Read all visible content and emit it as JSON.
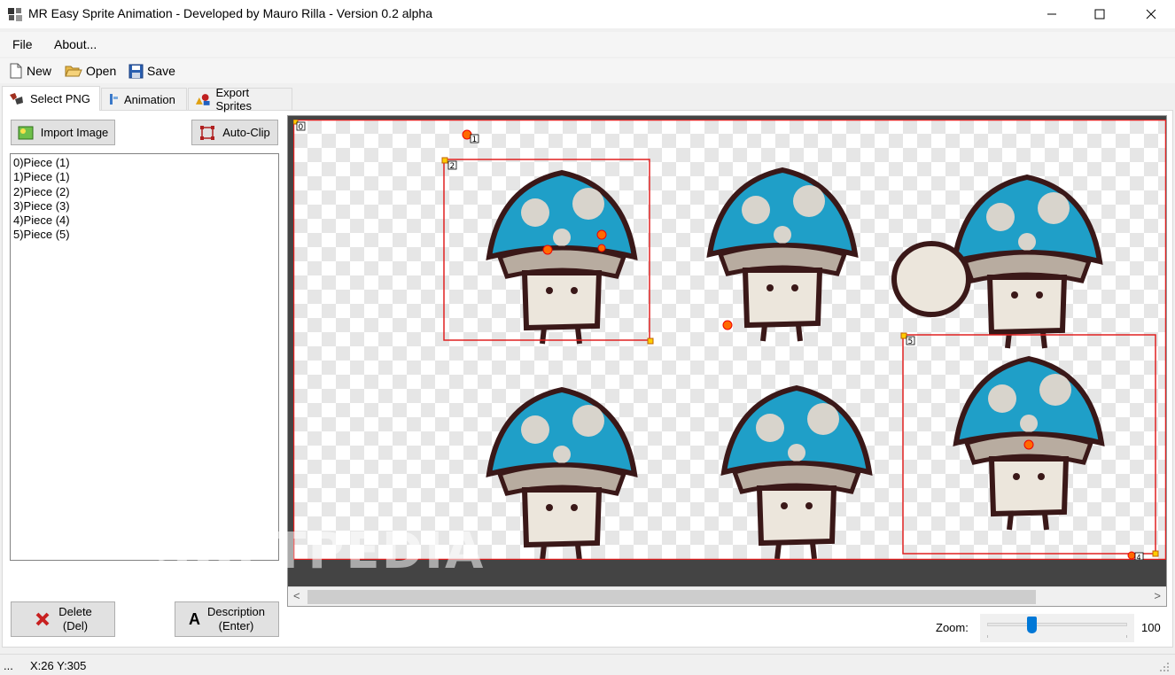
{
  "window": {
    "title": "MR Easy Sprite Animation - Developed by Mauro Rilla - Version 0.2 alpha"
  },
  "menu": {
    "items": [
      "File",
      "About..."
    ]
  },
  "toolbar": {
    "new_label": "New",
    "open_label": "Open",
    "save_label": "Save"
  },
  "tabs": [
    {
      "label": "Select PNG",
      "active": true
    },
    {
      "label": "Animation",
      "active": false
    },
    {
      "label": "Export Sprites",
      "active": false
    }
  ],
  "left_panel": {
    "import_label": "Import Image",
    "autoclip_label": "Auto-Clip",
    "pieces": [
      "0)Piece (1)",
      "1)Piece (1)",
      "2)Piece (2)",
      "3)Piece (3)",
      "4)Piece (4)",
      "5)Piece (5)"
    ],
    "delete_label": "Delete",
    "delete_key": "(Del)",
    "description_label": "Description",
    "description_key": "(Enter)"
  },
  "canvas": {
    "markers": {
      "m0": "0",
      "m1": "1",
      "m2": "2",
      "m5": "5",
      "m4": "4"
    }
  },
  "zoom": {
    "label": "Zoom:",
    "value": "100"
  },
  "status": {
    "prefix": "...",
    "coords": "X:26 Y:305"
  },
  "watermark": "SOFTPEDIA",
  "colors": {
    "accent": "#0078d7",
    "selection": "#e02020",
    "mushroom_cap": "#1f9fc8",
    "outline": "#3a1818"
  }
}
